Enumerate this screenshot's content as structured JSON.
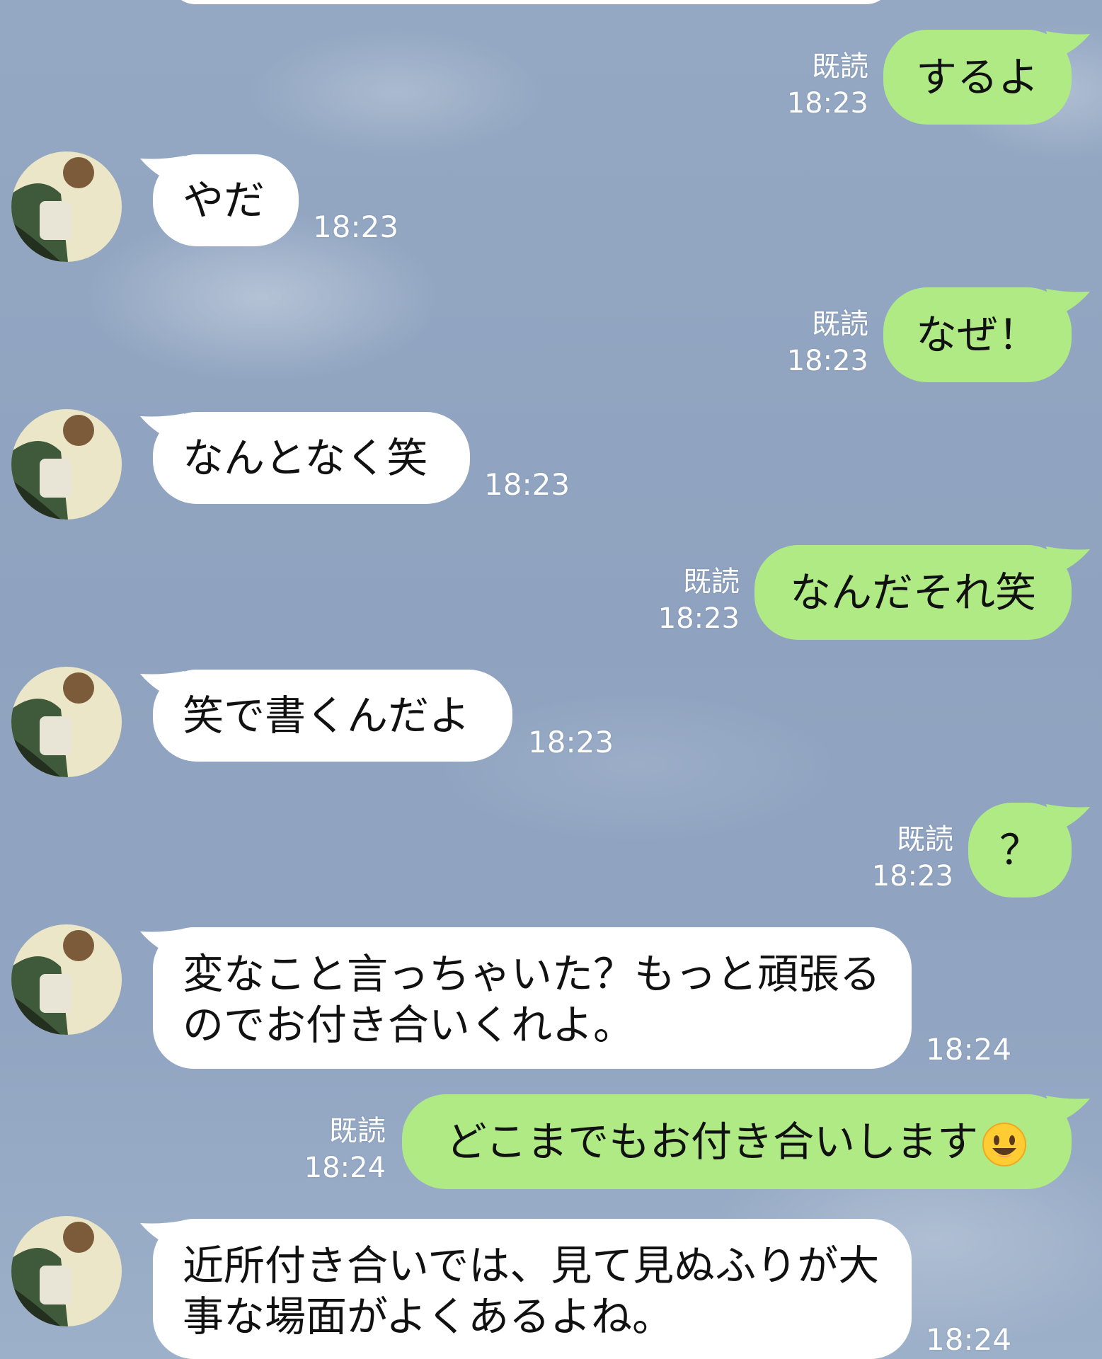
{
  "messages": [
    {
      "side": "out",
      "text": "するよ",
      "read": "既読",
      "time": "18:23"
    },
    {
      "side": "in",
      "text": "やだ",
      "time": "18:23"
    },
    {
      "side": "out",
      "text": "なぜ！",
      "read": "既読",
      "time": "18:23"
    },
    {
      "side": "in",
      "text": "なんとなく笑",
      "time": "18:23"
    },
    {
      "side": "out",
      "text": "なんだそれ笑",
      "read": "既読",
      "time": "18:23"
    },
    {
      "side": "in",
      "text": "笑で書くんだよ",
      "time": "18:23"
    },
    {
      "side": "out",
      "text": "？",
      "read": "既読",
      "time": "18:23"
    },
    {
      "side": "in",
      "text": "変なこと言っちゃいた？もっと頑張るのでお付き合いくれよ。",
      "time": "18:24"
    },
    {
      "side": "out",
      "text": "どこまでもお付き合いします",
      "emoji": "grinning-face-emoji",
      "read": "既読",
      "time": "18:24"
    },
    {
      "side": "in",
      "text": "近所付き合いでは、見て見ぬふりが大事な場面がよくあるよね。",
      "time": "18:24"
    }
  ],
  "colors": {
    "background": "#91a5c2",
    "incoming_bubble": "#ffffff",
    "outgoing_bubble": "#b0ea85",
    "meta_text": "#ffffff",
    "message_text": "#111111"
  }
}
